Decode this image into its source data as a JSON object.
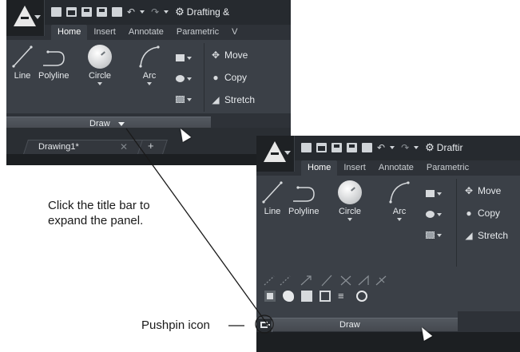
{
  "colors": {
    "ribbon_bg": "#3b4047",
    "titlebar_bg": "#262a2f",
    "panel_bar": "#4a4f55",
    "callout_line": "#1a1a1a"
  },
  "screenshot_collapsed": {
    "workspace_label": "Drafting &",
    "tabs": [
      "Home",
      "Insert",
      "Annotate",
      "Parametric",
      "V"
    ],
    "draw_tools": [
      "Line",
      "Polyline",
      "Circle",
      "Arc"
    ],
    "modify_tools": [
      "Move",
      "Copy",
      "Stretch"
    ],
    "panel_title": "Draw",
    "document_tab": "Drawing1*"
  },
  "screenshot_expanded": {
    "workspace_label": "Draftir",
    "tabs": [
      "Home",
      "Insert",
      "Annotate",
      "Parametric"
    ],
    "draw_tools": [
      "Line",
      "Polyline",
      "Circle",
      "Arc"
    ],
    "modify_tools": [
      "Move",
      "Copy",
      "Stretch"
    ],
    "panel_title": "Draw"
  },
  "annotations": {
    "expand_note": "Click the title bar to\nexpand the panel.",
    "pushpin_note": "Pushpin icon"
  },
  "icons": [
    "application-logo-icon",
    "new-icon",
    "open-icon",
    "save-icon",
    "save-as-icon",
    "print-icon",
    "undo-icon",
    "redo-icon",
    "gear-icon",
    "line-icon",
    "polyline-icon",
    "circle-icon",
    "arc-icon",
    "rectangle-icon",
    "hatch-icon",
    "gradient-icon",
    "move-icon",
    "copy-icon",
    "stretch-icon",
    "pushpin-icon",
    "close-icon",
    "plus-icon"
  ]
}
